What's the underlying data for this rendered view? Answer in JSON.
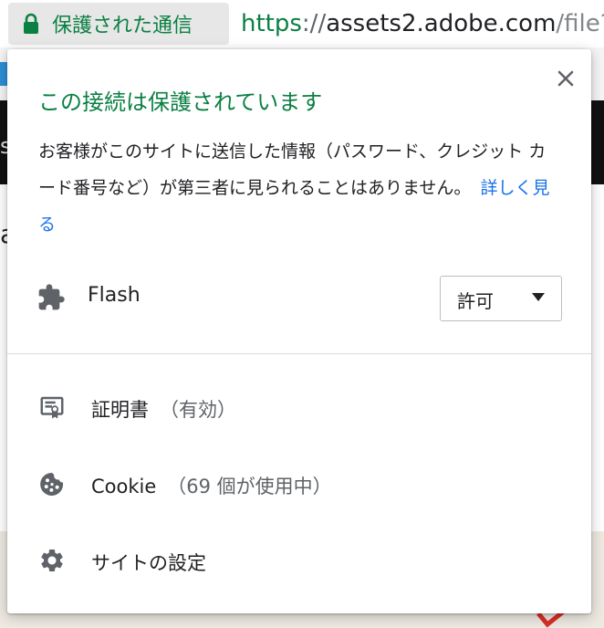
{
  "omnibox": {
    "security_label": "保護された通信",
    "url_scheme": "https",
    "url_separator": "://",
    "url_host": "assets2.adobe.com",
    "url_path": "/file?",
    "lock_icon": "lock-icon",
    "secure_color": "#0b8043"
  },
  "background": {
    "partial_letter_1": "s",
    "partial_letter_2": "a"
  },
  "bubble": {
    "title": "この接続は保護されています",
    "description": "お客様がこのサイトに送信した情報（パスワード、クレジット カード番号など）が第三者に見られることはありません。",
    "learn_more": "詳しく見る",
    "close_icon": "close-icon",
    "link_color": "#1a73e8",
    "permission": {
      "label": "Flash",
      "icon": "puzzle-piece-icon",
      "selected": "許可",
      "caret_icon": "caret-down-icon"
    },
    "rows": [
      {
        "label": "証明書",
        "sub": "（有効）",
        "icon": "certificate-icon"
      },
      {
        "label": "Cookie",
        "sub": "（69 個が使用中）",
        "icon": "cookie-icon"
      },
      {
        "label": "サイトの設定",
        "sub": "",
        "icon": "gear-icon"
      }
    ]
  }
}
